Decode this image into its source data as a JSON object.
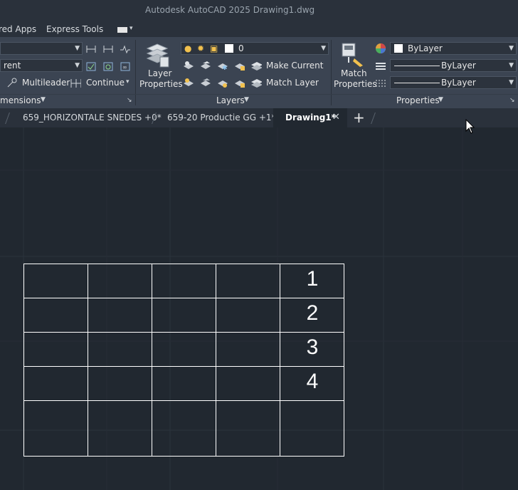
{
  "app": {
    "title": "Autodesk AutoCAD 2025    Drawing1.dwg"
  },
  "menu": {
    "tabs": [
      "red Apps",
      "Express Tools"
    ]
  },
  "ribbon": {
    "dimensions": {
      "combo1_value": "",
      "combo2_value": "rent",
      "multileader_label": "Multileader",
      "continue_label": "Continue",
      "panel_title": "mensions"
    },
    "layers": {
      "layer_properties_label_1": "Layer",
      "layer_properties_label_2": "Properties",
      "current_layer": "0",
      "make_current_label": "Make Current",
      "match_layer_label": "Match Layer",
      "panel_title": "Layers"
    },
    "properties": {
      "match_properties_label_1": "Match",
      "match_properties_label_2": "Properties",
      "color_value": "ByLayer",
      "linetype_value": "ByLayer",
      "lineweight_value": "ByLayer",
      "panel_title": "Properties"
    }
  },
  "doc_tabs": [
    {
      "label": "659_HORIZONTALE SNEDES +0*",
      "active": false
    },
    {
      "label": "659-20 Productie GG +1*",
      "active": false
    },
    {
      "label": "Drawing1*",
      "active": true
    }
  ],
  "drawing": {
    "table_rows": 5,
    "table_cols": 5,
    "numbers": [
      "1",
      "2",
      "3",
      "4"
    ]
  },
  "colors": {
    "canvas": "#212830",
    "ribbon": "#3b4452",
    "titlebar": "#2a313b",
    "lines": "#ffffff"
  }
}
